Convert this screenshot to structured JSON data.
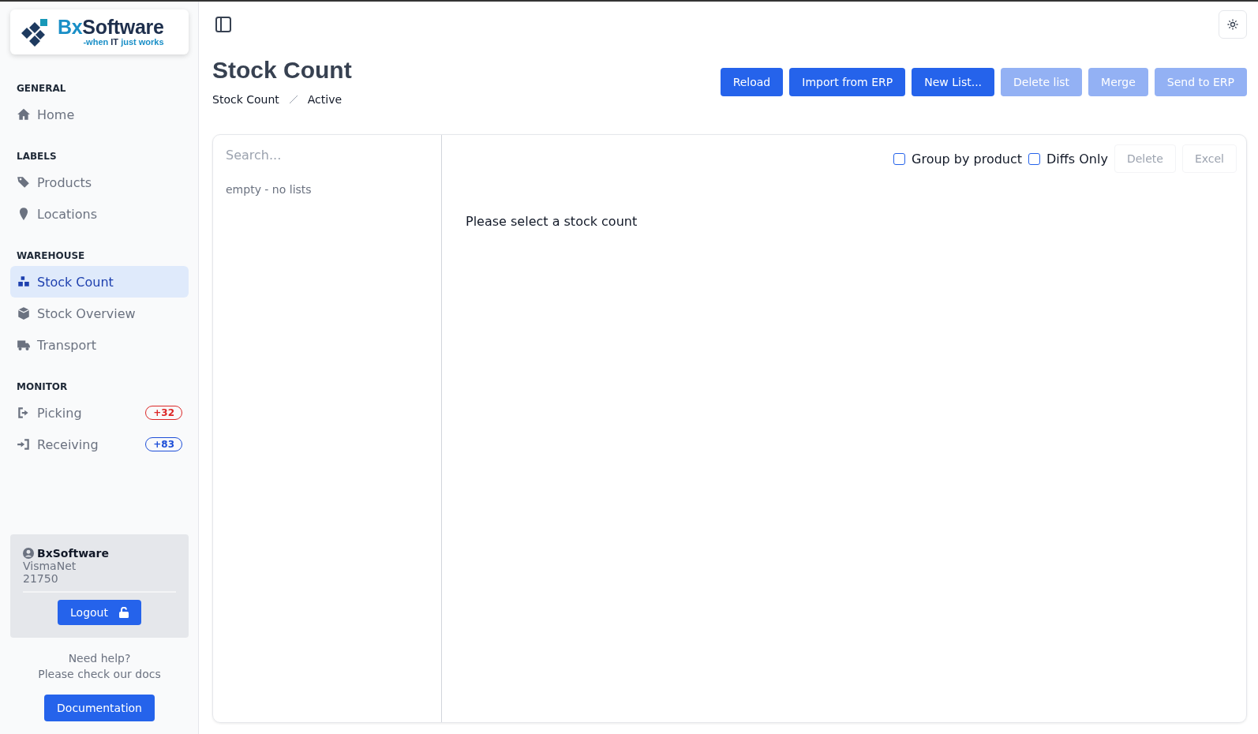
{
  "logo": {
    "title": [
      {
        "text": "Bx",
        "kind": "accent"
      },
      {
        "text": "Software",
        "kind": "main"
      }
    ],
    "tagline": [
      {
        "text": "-when ",
        "kind": "accent"
      },
      {
        "text": "IT",
        "kind": "main"
      },
      {
        "text": " just works",
        "kind": "accent"
      }
    ]
  },
  "sidebar": {
    "sections": [
      {
        "heading": "GENERAL",
        "items": [
          {
            "label": "Home",
            "selected": false
          }
        ]
      },
      {
        "heading": "LABELS",
        "items": [
          {
            "label": "Products",
            "selected": false
          },
          {
            "label": "Locations",
            "selected": false
          }
        ]
      },
      {
        "heading": "WAREHOUSE",
        "items": [
          {
            "label": "Stock Count",
            "selected": true
          },
          {
            "label": "Stock Overview",
            "selected": false
          },
          {
            "label": "Transport",
            "selected": false
          }
        ]
      },
      {
        "heading": "MONITOR",
        "items": [
          {
            "label": "Picking",
            "selected": false,
            "badge": "+32",
            "color": "#dc2626"
          },
          {
            "label": "Receiving",
            "selected": false,
            "badge": "+83",
            "color": "#1d4ed8"
          }
        ]
      }
    ]
  },
  "account": {
    "name": "BxSoftware",
    "system": "VismaNet",
    "number": "21750",
    "logout": "Logout"
  },
  "help": {
    "text": [
      "Need help?",
      "Please check our docs"
    ],
    "button": "Documentation"
  },
  "page": {
    "title": "Stock Count",
    "breadcrumb": [
      "Stock Count",
      "Active"
    ],
    "actions": [
      {
        "label": "Reload",
        "disabled": false
      },
      {
        "label": "Import from ERP",
        "disabled": false
      },
      {
        "label": "New List...",
        "disabled": false
      },
      {
        "label": "Delete list",
        "disabled": true
      },
      {
        "label": "Merge",
        "disabled": true
      },
      {
        "label": "Send to ERP",
        "disabled": true
      }
    ]
  },
  "lists": {
    "search": {
      "placeholder": "Search..."
    },
    "empty": "empty - no lists"
  },
  "detail": {
    "options": [
      {
        "label": "Group by product",
        "checked": false
      },
      {
        "label": "Diffs Only",
        "checked": false
      }
    ],
    "buttons": [
      {
        "label": "Delete",
        "disabled": true
      },
      {
        "label": "Excel",
        "disabled": true
      }
    ],
    "message": "Please select a stock count"
  }
}
